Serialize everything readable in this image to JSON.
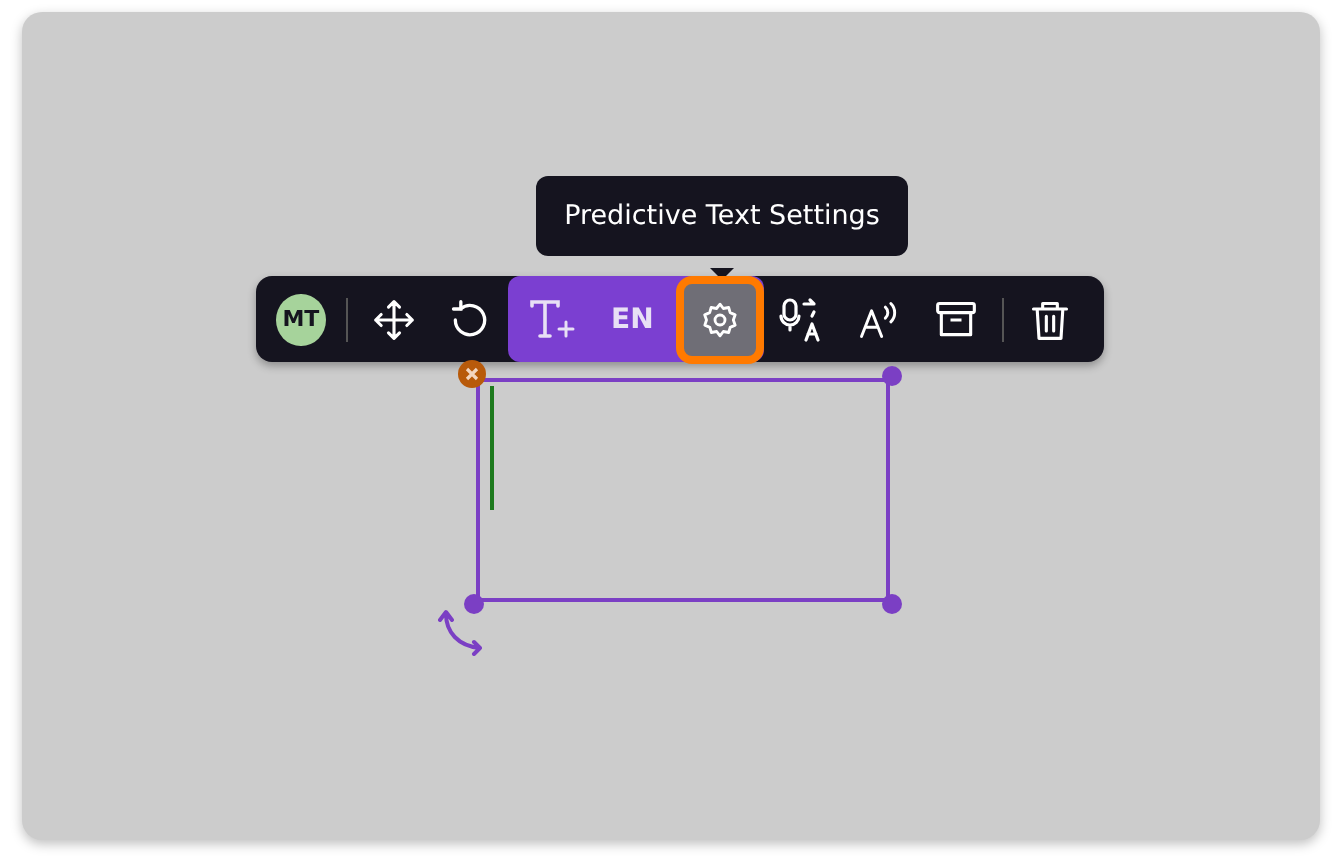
{
  "tooltip": {
    "text": "Predictive Text Settings"
  },
  "toolbar": {
    "items": [
      {
        "kind": "avatar",
        "initials": "MT"
      },
      {
        "kind": "divider"
      },
      {
        "kind": "move",
        "selected": false
      },
      {
        "kind": "rotate",
        "selected": false
      },
      {
        "kind": "group",
        "active": true,
        "items": [
          {
            "kind": "predictive-text",
            "selected": false
          },
          {
            "kind": "language",
            "label": "EN",
            "selected": false
          },
          {
            "kind": "settings",
            "selected": true
          }
        ]
      },
      {
        "kind": "voice",
        "selected": false
      },
      {
        "kind": "read-aloud",
        "selected": false
      },
      {
        "kind": "archive",
        "selected": false
      },
      {
        "kind": "divider"
      },
      {
        "kind": "delete",
        "selected": false
      }
    ]
  },
  "text_box": {
    "selected": true
  }
}
